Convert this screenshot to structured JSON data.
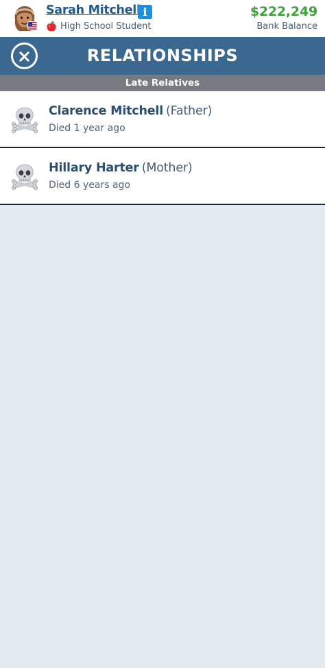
{
  "character": {
    "name": "Sarah Mitchell",
    "occupation": "High School Student",
    "balance": "$222,249",
    "balance_label": "Bank Balance",
    "info_icon": "info-icon",
    "avatar_icon": "avatar-face",
    "flag_icon": "us-flag-icon",
    "occupation_icon": "apple-icon"
  },
  "header": {
    "title": "RELATIONSHIPS",
    "close_icon": "close-icon"
  },
  "section": {
    "label": "Late Relatives"
  },
  "relatives": [
    {
      "name": "Clarence Mitchell",
      "role": "(Father)",
      "status": "Died 1 year ago",
      "icon": "skull-crossbones-icon"
    },
    {
      "name": "Hillary Harter",
      "role": "(Mother)",
      "status": "Died 6 years ago",
      "icon": "skull-crossbones-icon"
    }
  ],
  "colors": {
    "header_bg": "#3a6891",
    "section_bg": "#777b7f",
    "balance": "#3ea33a",
    "page_bg": "#e5eaef"
  }
}
